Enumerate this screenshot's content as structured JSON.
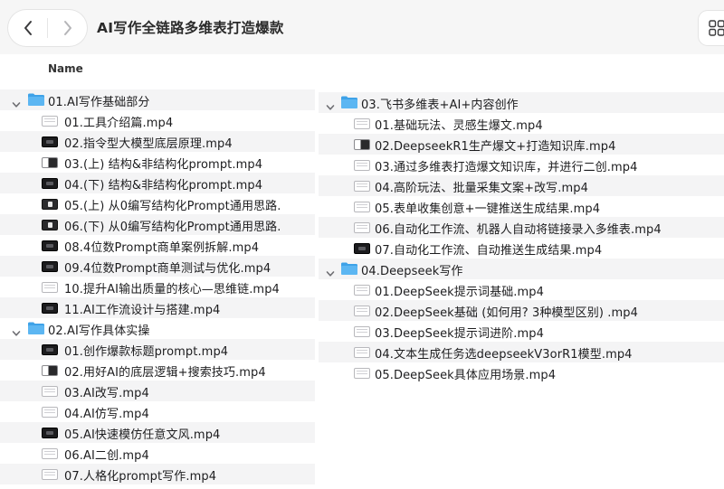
{
  "window": {
    "title": "AI写作全链路多维表打造爆款",
    "nav_back": "‹",
    "nav_forward": "›"
  },
  "columns": {
    "name": "Name"
  },
  "colors": {
    "folder": "#3ea2e8",
    "row_alt": "#f4f4f5",
    "chevron": "#6e6e73"
  },
  "left_panel": {
    "folders": [
      {
        "name": "01.AI写作基础部分",
        "files": [
          {
            "name": "01.工具介绍篇.mp4",
            "icon": "light"
          },
          {
            "name": "02.指令型大模型底层原理.mp4",
            "icon": "dark"
          },
          {
            "name": "03.(上) 结构&非结构化prompt.mp4",
            "icon": "mixed"
          },
          {
            "name": "04.(下) 结构&非结构化prompt.mp4",
            "icon": "dark"
          },
          {
            "name": "05.(上) 从0编写结构化Prompt通用思路.",
            "icon": "video"
          },
          {
            "name": "06.(下) 从0编写结构化Prompt通用思路.",
            "icon": "video"
          },
          {
            "name": "08.4位数Prompt商单案例拆解.mp4",
            "icon": "dark"
          },
          {
            "name": "09.4位数Prompt商单测试与优化.mp4",
            "icon": "dark"
          },
          {
            "name": "10.提升AI输出质量的核心—思维链.mp4",
            "icon": "light"
          },
          {
            "name": "11.AI工作流设计与搭建.mp4",
            "icon": "dark"
          }
        ]
      },
      {
        "name": "02.AI写作具体实操",
        "files": [
          {
            "name": "01.创作爆款标题prompt.mp4",
            "icon": "dark"
          },
          {
            "name": "02.用好AI的底层逻辑+搜索技巧.mp4",
            "icon": "mixed"
          },
          {
            "name": "03.AI改写.mp4",
            "icon": "light"
          },
          {
            "name": "04.AI仿写.mp4",
            "icon": "light"
          },
          {
            "name": "05.AI快速模仿任意文风.mp4",
            "icon": "dark"
          },
          {
            "name": "06.AI二创.mp4",
            "icon": "light"
          },
          {
            "name": "07.人格化prompt写作.mp4",
            "icon": "light"
          }
        ]
      }
    ]
  },
  "right_panel": {
    "folders": [
      {
        "name": "03.飞书多维表+AI+内容创作",
        "files": [
          {
            "name": "01.基础玩法、灵感生爆文.mp4",
            "icon": "light"
          },
          {
            "name": "02.DeepseekR1生产爆文+打造知识库.mp4",
            "icon": "mixed"
          },
          {
            "name": "03.通过多维表打造爆文知识库，并进行二创.mp4",
            "icon": "light"
          },
          {
            "name": "04.高阶玩法、批量采集文案+改写.mp4",
            "icon": "light"
          },
          {
            "name": "05.表单收集创意+一键推送生成结果.mp4",
            "icon": "light"
          },
          {
            "name": "06.自动化工作流、机器人自动将链接录入多维表.mp4",
            "icon": "light"
          },
          {
            "name": "07.自动化工作流、自动推送生成结果.mp4",
            "icon": "dark"
          }
        ]
      },
      {
        "name": "04.Deepseek写作",
        "files": [
          {
            "name": "01.DeepSeek提示词基础.mp4",
            "icon": "light"
          },
          {
            "name": "02.DeepSeek基础 (如何用? 3种模型区别) .mp4",
            "icon": "light"
          },
          {
            "name": "03.DeepSeek提示词进阶.mp4",
            "icon": "light"
          },
          {
            "name": "04.文本生成任务选deepseekV3orR1模型.mp4",
            "icon": "light"
          },
          {
            "name": "05.DeepSeek具体应用场景.mp4",
            "icon": "light"
          }
        ]
      }
    ]
  }
}
